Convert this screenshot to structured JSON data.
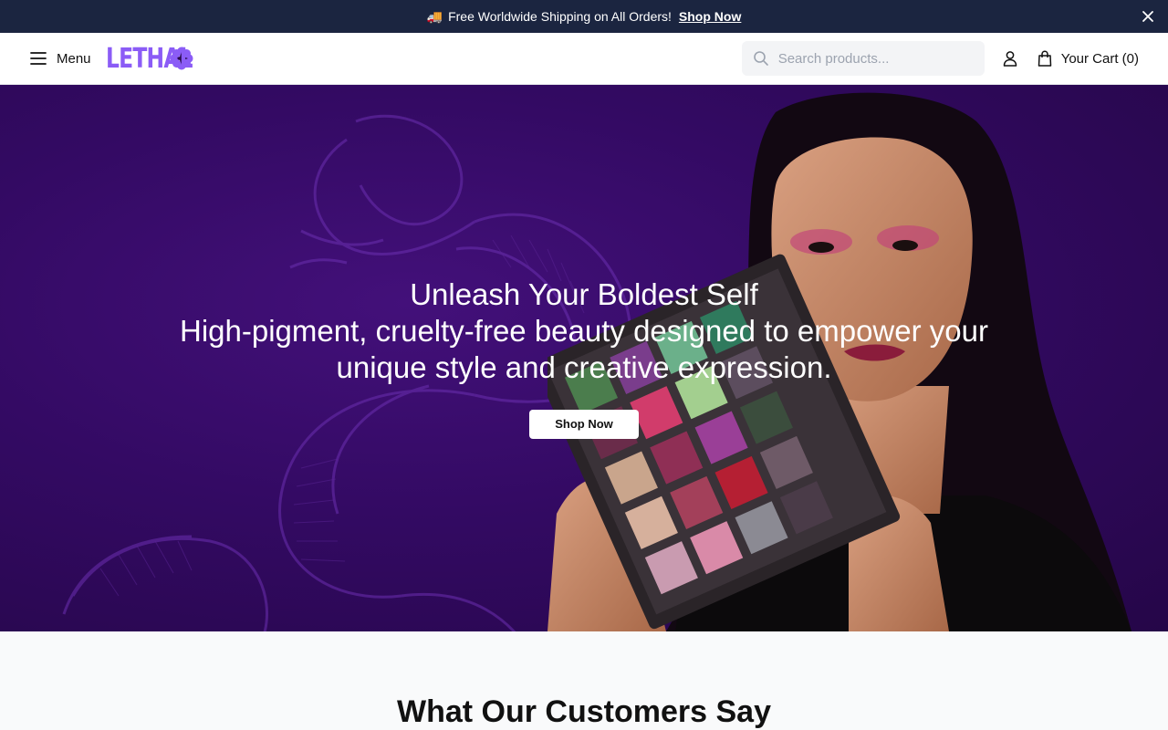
{
  "announcement": {
    "icon": "truck-icon",
    "text": "Free Worldwide Shipping on All Orders!",
    "link_label": "Shop Now"
  },
  "header": {
    "menu_label": "Menu",
    "logo_text": "LETHAL",
    "search_placeholder": "Search products...",
    "cart_label": "Your Cart (0)"
  },
  "hero": {
    "title": "Unleash Your Boldest Self",
    "subtitle": "High-pigment, cruelty-free beauty designed to empower your unique style and creative expression.",
    "cta_label": "Shop Now"
  },
  "testimonials": {
    "heading": "What Our Customers Say"
  },
  "colors": {
    "announcement_bg": "#1b2540",
    "brand_purple": "#8b5cf6",
    "hero_bg": "#330a63",
    "section_bg": "#f9fafb"
  }
}
